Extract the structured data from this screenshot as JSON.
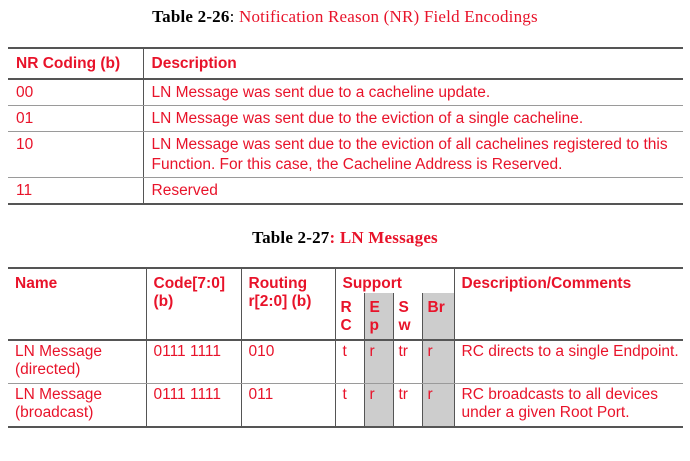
{
  "table1": {
    "caption_number": "Table 2-26",
    "caption_sep": ":",
    "caption_title": " Notification Reason (NR) Field Encodings",
    "headers": [
      "NR Coding (b)",
      "Description"
    ],
    "rows": [
      {
        "code": "00",
        "desc": "LN Message was sent due to a cacheline update."
      },
      {
        "code": "01",
        "desc": "LN Message was sent due to the eviction of a single cacheline."
      },
      {
        "code": "10",
        "desc": "LN Message was sent due to the eviction of all cachelines registered to this Function.  For this case, the Cacheline Address is Reserved."
      },
      {
        "code": "11",
        "desc": "Reserved"
      }
    ]
  },
  "table2": {
    "caption_number": "Table 2-27",
    "caption_title": ": LN Messages",
    "headers": {
      "name": "Name",
      "code": "Code[7:0] (b)",
      "routing": "Routing r[2:0] (b)",
      "support": "Support",
      "desc": "Description/Comments"
    },
    "support_cols": [
      "R C",
      "E p",
      "S w",
      "Br"
    ],
    "rows": [
      {
        "name": "LN Message (directed)",
        "code": "0111 1111",
        "routing": "010",
        "rc": "t",
        "ep": "r",
        "sw": "tr",
        "br": "r",
        "desc": "RC directs to a single Endpoint."
      },
      {
        "name": "LN Message (broadcast)",
        "code": "0111 1111",
        "routing": "011",
        "rc": "t",
        "ep": "r",
        "sw": "tr",
        "br": "r",
        "desc": "RC broadcasts to all devices under a given Root Port."
      }
    ]
  }
}
